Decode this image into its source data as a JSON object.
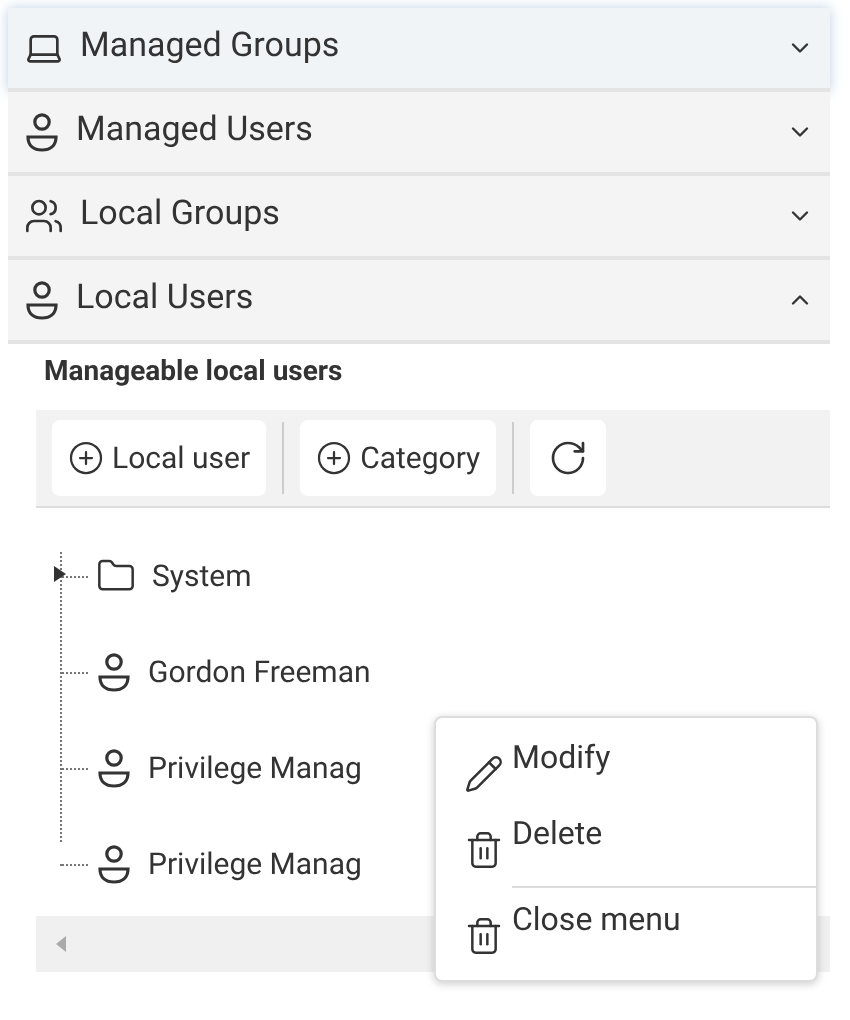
{
  "sections": [
    {
      "title": "Managed Groups",
      "kind": "laptop",
      "expanded": false,
      "selected": true
    },
    {
      "title": "Managed Users",
      "kind": "user",
      "expanded": false,
      "selected": false
    },
    {
      "title": "Local Groups",
      "kind": "users",
      "expanded": false,
      "selected": false
    },
    {
      "title": "Local Users",
      "kind": "user",
      "expanded": true,
      "selected": false
    }
  ],
  "panel": {
    "heading": "Manageable local users",
    "toolbar": [
      {
        "kind": "add",
        "label": "Local user"
      },
      {
        "kind": "add",
        "label": "Category"
      },
      {
        "kind": "refresh"
      }
    ],
    "tree": [
      {
        "kind": "folder",
        "label": "System",
        "expanded": false
      },
      {
        "kind": "user",
        "label": "Gordon Freeman"
      },
      {
        "kind": "user",
        "label": "Privilege Manag"
      },
      {
        "kind": "user",
        "label": "Privilege Manag"
      }
    ]
  },
  "context_menu": [
    {
      "kind": "edit",
      "label": "Modify"
    },
    {
      "kind": "delete",
      "label": "Delete"
    },
    {
      "kind": "close",
      "label": "Close menu"
    }
  ]
}
